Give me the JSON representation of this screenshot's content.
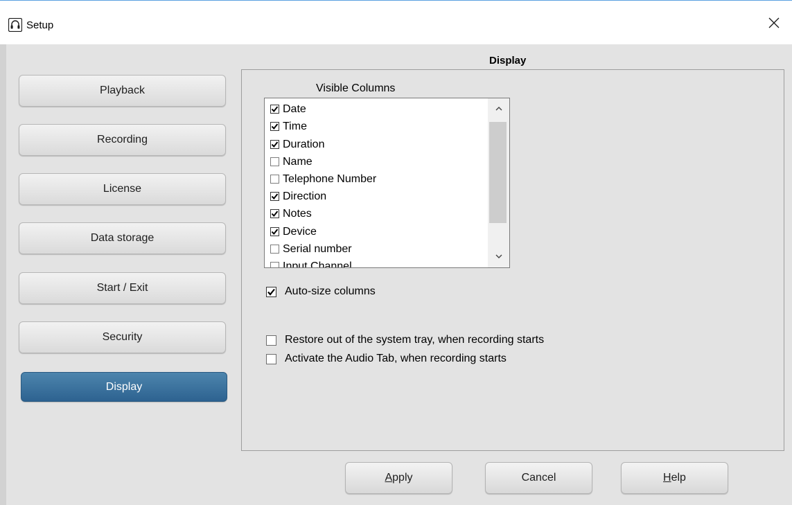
{
  "window": {
    "title": "Setup",
    "icon": "headset-icon"
  },
  "sidebar": {
    "items": [
      {
        "label": "Playback",
        "active": false
      },
      {
        "label": "Recording",
        "active": false
      },
      {
        "label": "License",
        "active": false
      },
      {
        "label": "Data storage",
        "active": false
      },
      {
        "label": "Start / Exit",
        "active": false
      },
      {
        "label": "Security",
        "active": false
      },
      {
        "label": "Display",
        "active": true
      }
    ]
  },
  "main": {
    "heading": "Display",
    "visible_columns": {
      "label": "Visible Columns",
      "items": [
        {
          "label": "Date",
          "checked": true
        },
        {
          "label": "Time",
          "checked": true
        },
        {
          "label": "Duration",
          "checked": true
        },
        {
          "label": "Name",
          "checked": false
        },
        {
          "label": "Telephone Number",
          "checked": false
        },
        {
          "label": "Direction",
          "checked": true
        },
        {
          "label": "Notes",
          "checked": true
        },
        {
          "label": "Device",
          "checked": true
        },
        {
          "label": "Serial number",
          "checked": false
        },
        {
          "label": "Input Channel",
          "checked": false
        }
      ]
    },
    "auto_size": {
      "label": "Auto-size columns",
      "checked": true
    },
    "restore_tray": {
      "label": "Restore out of the system tray, when recording starts",
      "checked": false
    },
    "activate_audio": {
      "label": "Activate the Audio Tab, when recording starts",
      "checked": false
    }
  },
  "buttons": {
    "apply": "Apply",
    "cancel": "Cancel",
    "help": "Help"
  },
  "colors": {
    "active_nav": "#3a729e",
    "background": "#e3e3e3",
    "accent_line": "#5aa0e0"
  }
}
